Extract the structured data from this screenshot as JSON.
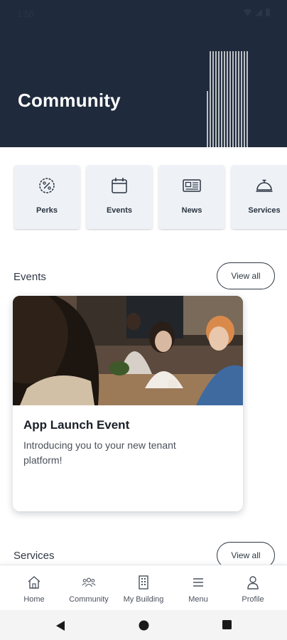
{
  "status_bar": {
    "time": "1:58"
  },
  "header": {
    "title": "Community"
  },
  "quick_actions": [
    {
      "label": "Perks",
      "icon": "percent-badge-icon"
    },
    {
      "label": "Events",
      "icon": "calendar-icon"
    },
    {
      "label": "News",
      "icon": "newspaper-icon"
    },
    {
      "label": "Services",
      "icon": "service-bell-icon"
    }
  ],
  "events_section": {
    "title": "Events",
    "view_all": "View all",
    "card": {
      "title": "App Launch Event",
      "description": "Introducing you to your new tenant platform!"
    }
  },
  "services_section": {
    "title": "Services",
    "view_all": "View all"
  },
  "bottom_nav": [
    {
      "label": "Home",
      "icon": "home-icon"
    },
    {
      "label": "Community",
      "icon": "community-icon"
    },
    {
      "label": "My Building",
      "icon": "building-icon"
    },
    {
      "label": "Menu",
      "icon": "menu-icon"
    },
    {
      "label": "Profile",
      "icon": "profile-icon"
    }
  ],
  "colors": {
    "header_bg": "#1f2a3c",
    "card_bg": "#eef2f6",
    "text_dark": "#1f2530"
  }
}
